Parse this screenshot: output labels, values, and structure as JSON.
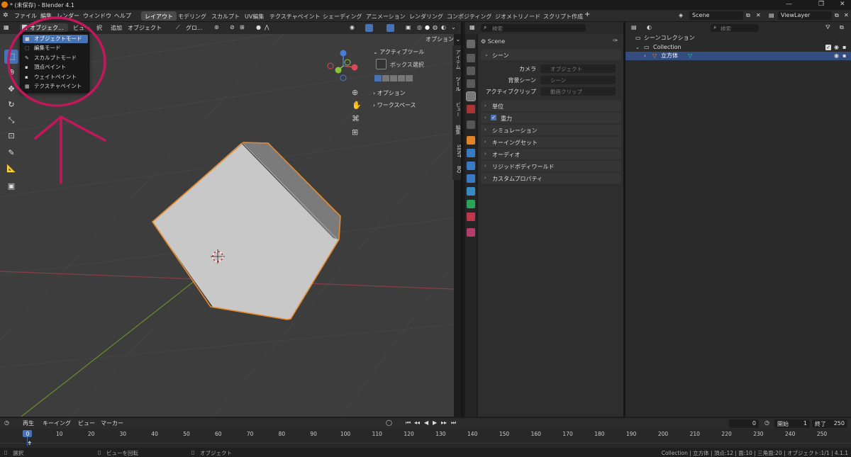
{
  "window": {
    "title": "* (未保存) - Blender 4.1"
  },
  "menus": [
    "ファイル",
    "編集",
    "レンダー",
    "ウィンドウ",
    "ヘルプ"
  ],
  "workspaces": [
    "レイアウト",
    "モデリング",
    "スカルプト",
    "UV編集",
    "テクスチャペイント",
    "シェーディング",
    "アニメーション",
    "レンダリング",
    "コンポジティング",
    "ジオメトリノード",
    "スクリプト作成"
  ],
  "active_workspace": "レイアウト",
  "scene_field": "Scene",
  "viewlayer_field": "ViewLayer",
  "viewport_header": {
    "mode": "オブジェク...",
    "view": "ビュー",
    "select": "択",
    "add": "追加",
    "object": "オブジェクト",
    "transform": "グロ...",
    "options": "オプション"
  },
  "mode_menu": [
    {
      "label": "オブジェクトモード",
      "icon": "■",
      "active": true
    },
    {
      "label": "編集モード",
      "icon": "⬚",
      "active": false
    },
    {
      "label": "スカルプトモード",
      "icon": "✎",
      "active": false
    },
    {
      "label": "頂点ペイント",
      "icon": "▪",
      "active": false
    },
    {
      "label": "ウェイトペイント",
      "icon": "▪",
      "active": false
    },
    {
      "label": "テクスチャペイント",
      "icon": "▦",
      "active": false
    }
  ],
  "n_panel": {
    "active_tool": "アクティブツール",
    "box_select": "ボックス選択",
    "options": "オプション",
    "workspace": "ワークスペース",
    "tabs": [
      "アイテム",
      "ツール",
      "ビュー",
      "編集",
      "SENT",
      "BQ"
    ]
  },
  "properties": {
    "breadcrumb": "Scene",
    "scene_section": "シーン",
    "camera_label": "カメラ",
    "camera_placeholder": "オブジェクト",
    "bg_label": "背景シーン",
    "bg_placeholder": "シーン",
    "clip_label": "アクティブクリップ",
    "clip_placeholder": "動画クリップ",
    "sections": [
      "単位",
      "重力",
      "シミュレーション",
      "キーイングセット",
      "オーディオ",
      "リジッドボディワールド",
      "カスタムプロパティ"
    ],
    "gravity_checked": true
  },
  "outliner": {
    "search_placeholder": "検索",
    "root": "シーンコレクション",
    "collection": "Collection",
    "object": "立方体"
  },
  "search_placeholder": "検索",
  "timeline": {
    "playback": "再生",
    "keying": "キーイング",
    "view": "ビュー",
    "marker": "マーカー",
    "current_frame": "0",
    "start_label": "開始",
    "start": "1",
    "end_label": "終了",
    "end": "250",
    "ticks": [
      "0",
      "10",
      "20",
      "30",
      "40",
      "50",
      "60",
      "70",
      "80",
      "90",
      "100",
      "110",
      "120",
      "130",
      "140",
      "150",
      "160",
      "170",
      "180",
      "190",
      "200",
      "210",
      "220",
      "230",
      "240",
      "250"
    ]
  },
  "status": {
    "select": "選択",
    "rotate": "ビューを回転",
    "object": "オブジェクト",
    "info": "Collection | 立方体 | 頂点:12 | 面:10 | 三角面:20 | オブジェクト:1/1 | 4.1.1"
  },
  "colors": {
    "accent": "#4772b3",
    "selection_orange": "#e88a2a",
    "annotation": "#c2185b"
  }
}
